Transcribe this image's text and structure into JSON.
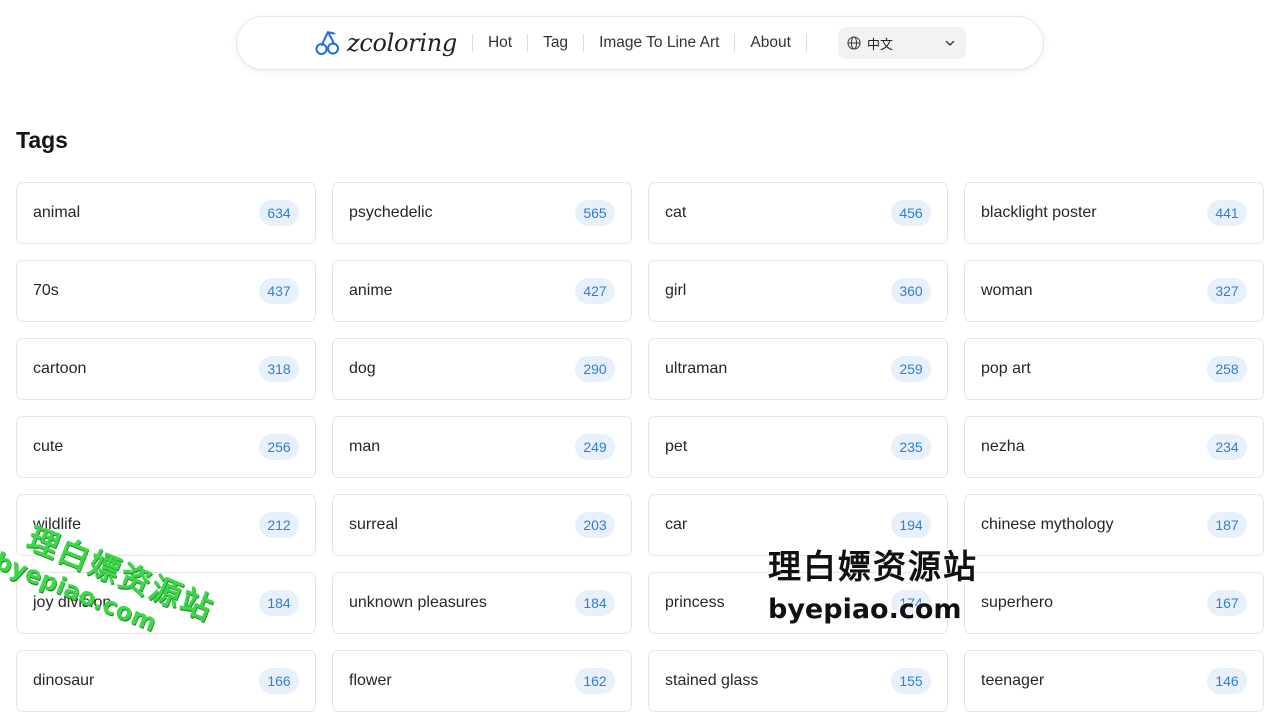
{
  "header": {
    "brand": "zcoloring",
    "nav": [
      {
        "label": "Hot"
      },
      {
        "label": "Tag"
      },
      {
        "label": "Image To Line Art"
      },
      {
        "label": "About"
      }
    ],
    "language": "中文"
  },
  "main": {
    "title": "Tags",
    "tags": [
      {
        "name": "animal",
        "count": "634"
      },
      {
        "name": "psychedelic",
        "count": "565"
      },
      {
        "name": "cat",
        "count": "456"
      },
      {
        "name": "blacklight poster",
        "count": "441"
      },
      {
        "name": "70s",
        "count": "437"
      },
      {
        "name": "anime",
        "count": "427"
      },
      {
        "name": "girl",
        "count": "360"
      },
      {
        "name": "woman",
        "count": "327"
      },
      {
        "name": "cartoon",
        "count": "318"
      },
      {
        "name": "dog",
        "count": "290"
      },
      {
        "name": "ultraman",
        "count": "259"
      },
      {
        "name": "pop art",
        "count": "258"
      },
      {
        "name": "cute",
        "count": "256"
      },
      {
        "name": "man",
        "count": "249"
      },
      {
        "name": "pet",
        "count": "235"
      },
      {
        "name": "nezha",
        "count": "234"
      },
      {
        "name": "wildlife",
        "count": "212"
      },
      {
        "name": "surreal",
        "count": "203"
      },
      {
        "name": "car",
        "count": "194"
      },
      {
        "name": "chinese mythology",
        "count": "187"
      },
      {
        "name": "joy division",
        "count": "184"
      },
      {
        "name": "unknown pleasures",
        "count": "184"
      },
      {
        "name": "princess",
        "count": "174"
      },
      {
        "name": "superhero",
        "count": "167"
      },
      {
        "name": "dinosaur",
        "count": "166"
      },
      {
        "name": "flower",
        "count": "162"
      },
      {
        "name": "stained glass",
        "count": "155"
      },
      {
        "name": "teenager",
        "count": "146"
      }
    ]
  },
  "watermarks": {
    "green_line1": "理白嫖资源站",
    "green_line2": "byepiao.com",
    "black_line1": "理白嫖资源站",
    "black_line2": "byepiao.com"
  },
  "colors": {
    "accent": "#2d7fd6",
    "badge_bg": "#e8f1fb",
    "logo_blue": "#1f6fe0"
  },
  "icons": {
    "logo": "cherry-icon",
    "language": "globe-icon",
    "dropdown": "chevron-down-icon"
  }
}
